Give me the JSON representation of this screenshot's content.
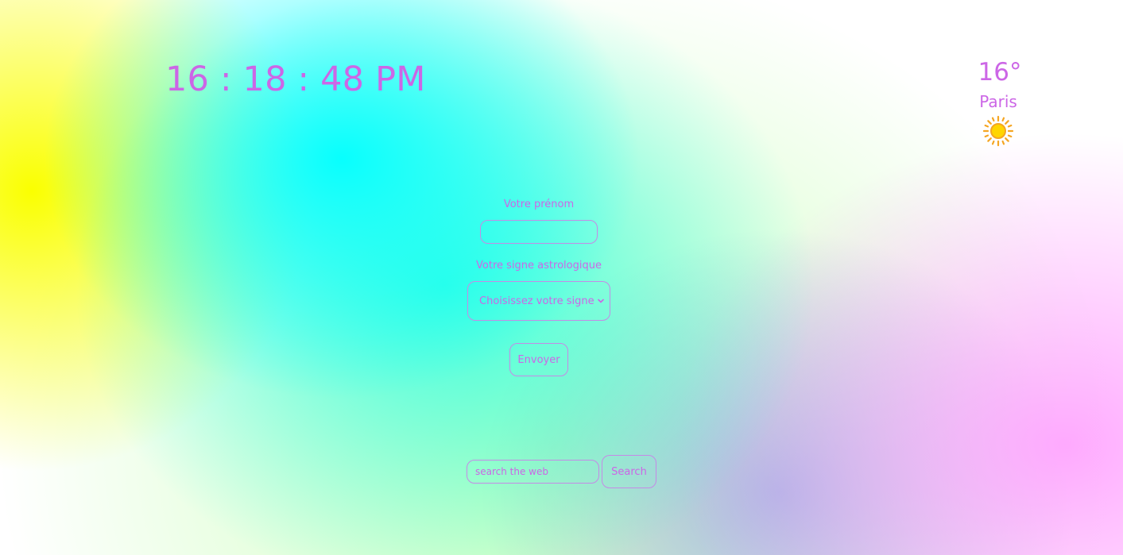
{
  "clock": {
    "time": "16 : 18 : 48 PM"
  },
  "weather": {
    "temperature": "16°",
    "city": "Paris",
    "icon": "sun-icon",
    "icon_color": "#f7c800"
  },
  "form": {
    "name_label": "Votre prénom",
    "name_value": "",
    "sign_label": "Votre signe astrologique",
    "sign_selected": "Choisissez votre signe",
    "submit_label": "Envoyer"
  },
  "search": {
    "placeholder": "search the web",
    "button_label": "Search"
  },
  "colors": {
    "text": "#cc66e6",
    "border": "#c58ae6",
    "yellow": "#faff00",
    "cyan": "#00ffff",
    "pink": "#ffa0ff"
  }
}
